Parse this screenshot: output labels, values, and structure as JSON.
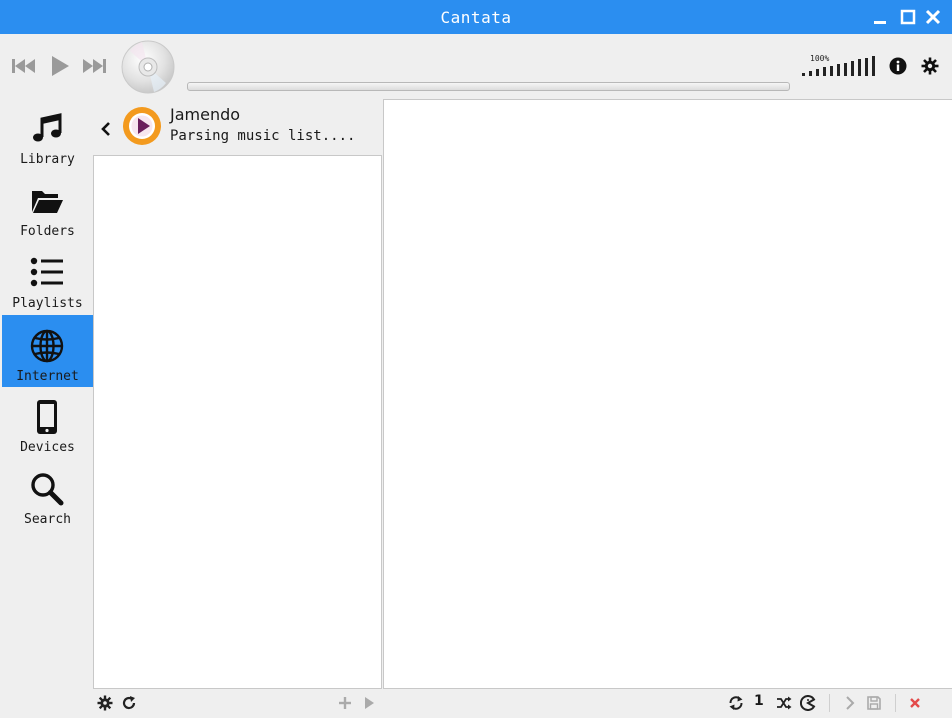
{
  "window": {
    "title": "Cantata"
  },
  "toolbar": {
    "volume_label": "100%",
    "volume_percent": 100
  },
  "sidebar": {
    "items": [
      {
        "label": "Library",
        "icon": "music-note-icon",
        "active": false
      },
      {
        "label": "Folders",
        "icon": "folder-icon",
        "active": false
      },
      {
        "label": "Playlists",
        "icon": "list-icon",
        "active": false
      },
      {
        "label": "Internet",
        "icon": "globe-icon",
        "active": true
      },
      {
        "label": "Devices",
        "icon": "phone-icon",
        "active": false
      },
      {
        "label": "Search",
        "icon": "search-icon",
        "active": false
      }
    ]
  },
  "service": {
    "name": "Jamendo",
    "status": "Parsing music list...."
  },
  "playqueue": {
    "single_label": "1"
  },
  "colors": {
    "accent": "#2b8ef0",
    "remove": "#e34a4a"
  }
}
